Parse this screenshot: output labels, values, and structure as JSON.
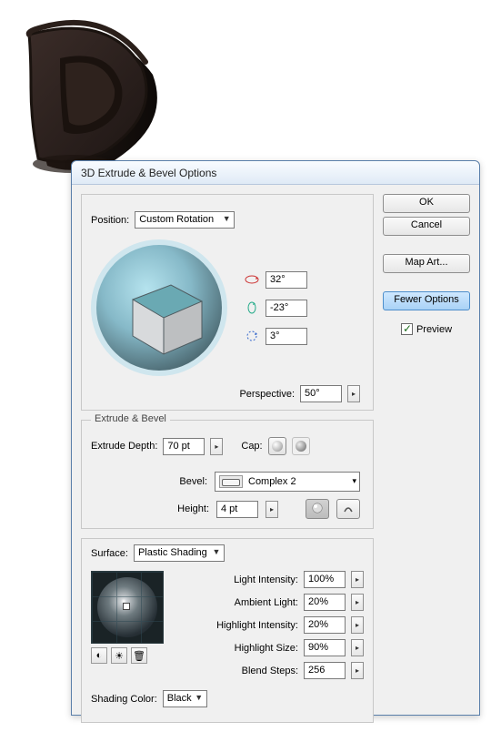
{
  "dialog": {
    "title": "3D Extrude & Bevel Options"
  },
  "buttons": {
    "ok": "OK",
    "cancel": "Cancel",
    "map_art": "Map Art...",
    "fewer_options": "Fewer Options",
    "preview": "Preview"
  },
  "position": {
    "label": "Position:",
    "value": "Custom Rotation",
    "rot_x": "32°",
    "rot_y": "-23°",
    "rot_z": "3°",
    "perspective_label": "Perspective:",
    "perspective": "50°"
  },
  "extrude": {
    "group_label": "Extrude & Bevel",
    "depth_label": "Extrude Depth:",
    "depth": "70 pt",
    "cap_label": "Cap:",
    "bevel_label": "Bevel:",
    "bevel": "Complex 2",
    "height_label": "Height:",
    "height": "4 pt"
  },
  "surface": {
    "group_label": "Surface:",
    "value": "Plastic Shading",
    "light_intensity_label": "Light Intensity:",
    "light_intensity": "100%",
    "ambient_label": "Ambient Light:",
    "ambient": "20%",
    "highlight_intensity_label": "Highlight Intensity:",
    "highlight_intensity": "20%",
    "highlight_size_label": "Highlight Size:",
    "highlight_size": "90%",
    "blend_steps_label": "Blend Steps:",
    "blend_steps": "256",
    "shading_color_label": "Shading Color:",
    "shading_color": "Black"
  }
}
